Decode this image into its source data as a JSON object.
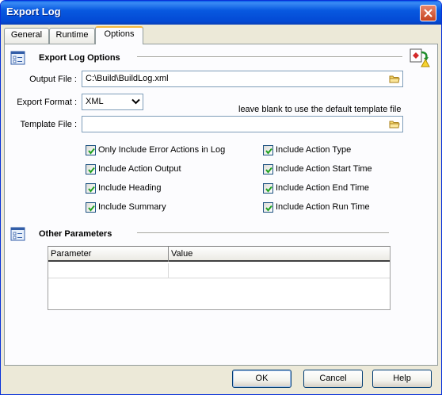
{
  "window": {
    "title": "Export Log"
  },
  "tabs": [
    {
      "label": "General",
      "active": false
    },
    {
      "label": "Runtime",
      "active": false
    },
    {
      "label": "Options",
      "active": true
    }
  ],
  "export_options": {
    "section_title": "Export Log Options",
    "output_file_label": "Output File :",
    "output_file_value": "C:\\Build\\BuildLog.xml",
    "export_format_label": "Export Format :",
    "export_format_value": "XML",
    "template_hint": "leave blank to use the default template file",
    "template_file_label": "Template File :",
    "template_file_value": ""
  },
  "checkboxes_left": [
    {
      "label": "Only Include Error Actions in Log",
      "checked": true
    },
    {
      "label": "Include Action Output",
      "checked": true
    },
    {
      "label": "Include Heading",
      "checked": true
    },
    {
      "label": "Include Summary",
      "checked": true
    }
  ],
  "checkboxes_right": [
    {
      "label": "Include Action Type",
      "checked": true
    },
    {
      "label": "Include Action Start Time",
      "checked": true
    },
    {
      "label": "Include Action End Time",
      "checked": true
    },
    {
      "label": "Include Action Run Time",
      "checked": true
    }
  ],
  "other_params": {
    "section_title": "Other Parameters",
    "columns": [
      "Parameter",
      "Value"
    ],
    "rows": [
      [
        "",
        ""
      ]
    ]
  },
  "buttons": {
    "ok": "OK",
    "cancel": "Cancel",
    "help": "Help"
  },
  "colors": {
    "titlebar": "#0859e0",
    "accent_tab": "#f5b83d",
    "checkmark": "#21a121"
  }
}
